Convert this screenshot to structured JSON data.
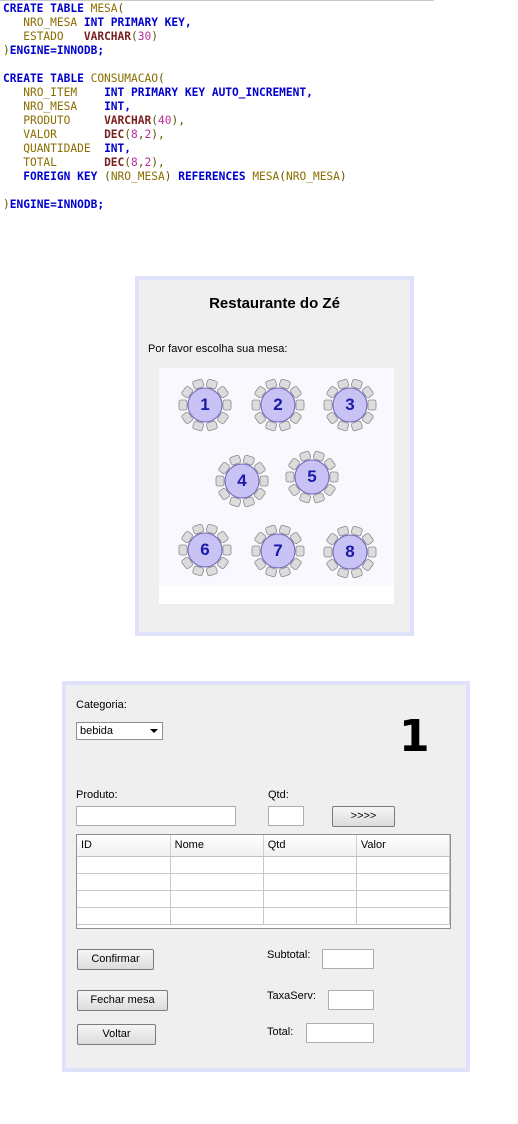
{
  "sql": {
    "mesa_create": "CREATE TABLE",
    "mesa_name": "MESA",
    "nro_mesa": "NRO_MESA",
    "int_pk": "INT PRIMARY KEY",
    "estado": "ESTADO",
    "varchar": "VARCHAR",
    "n30": "30",
    "engine_kw": "ENGINE",
    "engine_val": "INNODB",
    "consumacao_name": "CONSUMACAO",
    "nro_item": "NRO_ITEM",
    "int_pk_ai": "INT PRIMARY KEY AUTO_INCREMENT",
    "int_kw": "INT",
    "produto": "PRODUTO",
    "n40": "40",
    "valor": "VALOR",
    "dec": "DEC",
    "n8": "8",
    "n2": "2",
    "quantidade": "QUANTIDADE",
    "total": "TOTAL",
    "foreign_key": "FOREIGN KEY",
    "references": "REFERENCES"
  },
  "table_window": {
    "title": "Restaurante do Zé",
    "prompt": "Por favor escolha sua mesa:",
    "tables": [
      "1",
      "2",
      "3",
      "4",
      "5",
      "6",
      "7",
      "8"
    ]
  },
  "order_window": {
    "category_label": "Categoria:",
    "category_value": "bebida",
    "table_number": "1",
    "product_label": "Produto:",
    "qty_label": "Qtd:",
    "add_button": ">>>>",
    "columns": [
      "ID",
      "Nome",
      "Qtd",
      "Valor"
    ],
    "confirm_button": "Confirmar",
    "close_button": "Fechar mesa",
    "back_button": "Voltar",
    "subtotal_label": "Subtotal:",
    "service_label": "TaxaServ:",
    "total_label": "Total:"
  }
}
